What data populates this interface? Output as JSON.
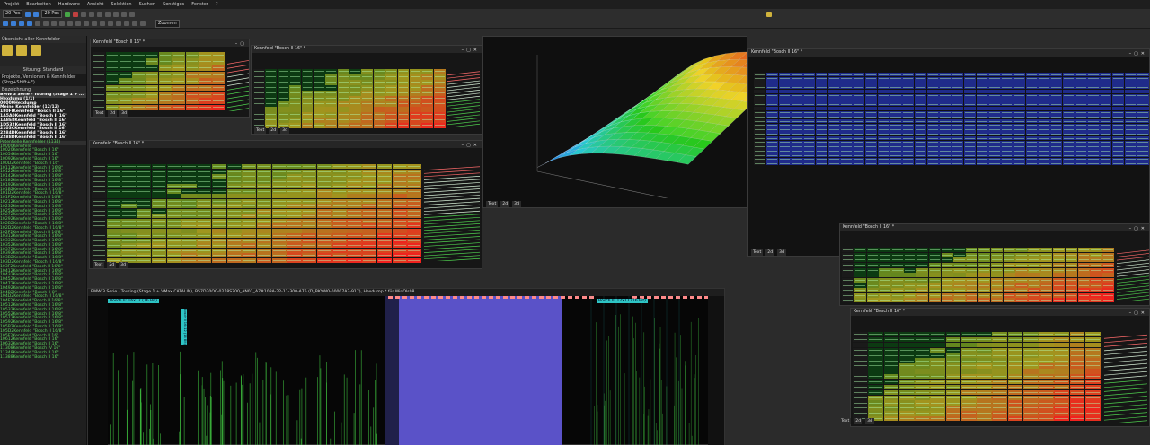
{
  "menu": [
    "Projekt",
    "Bearbeiten",
    "Hardware",
    "Ansicht",
    "Selektion",
    "Suchen",
    "Sonstiges",
    "Fenster",
    "?"
  ],
  "toolbar": {
    "addr_combo": "20 Pos",
    "zoom_combo": "20 Pos",
    "zoom_label": "Zoomen"
  },
  "left_panel": {
    "title": "Übersicht aller Kennfelder",
    "mode_label": "Sitzung: Standard",
    "project_label": "Projekte, Versionen & Kennfelder (Strg+Shift+F)",
    "column_label": "Bezeichnung",
    "tree_header": "BMW 3 Serie - Touring (Stage 1 + ...",
    "items_white": [
      "Hexdump (1/1)",
      "00000Hexdump",
      "Meine Kennfelder (12/12)",
      "180FIKennfeld \"Bosch II 16\"",
      "1A5A0Kennfeld \"Bosch II 16\"",
      "1A8E8Kennfeld \"Bosch II 16\"",
      "1D532Kennfeld \"Bosch II 16\"",
      "2103CKennfeld \"Bosch II 16\"",
      "2284DKennfeld \"Bosch II 16\"",
      "2288DKennfeld \"Bosch II 16\""
    ],
    "items_green_header": "Potentielle Kennfelder (1134)",
    "items_green": [
      "10000Kennfeld",
      "10020Kennfeld \"Bosch II 16\"",
      "10054Kennfeld \"Bosch II 16\"",
      "10092Kennfeld \"Bosch II 16\"",
      "100D2Kennfeld \"Bosch II 16\"",
      "10112Kennfeld \"Bosch II 16/8\"",
      "10122Kennfeld \"Bosch II 16/8\"",
      "10142Kennfeld \"Bosch II 16/8\"",
      "10182Kennfeld \"Bosch II 16/8\"",
      "10192Kennfeld \"Bosch II 16/8\"",
      "101B2Kennfeld \"Bosch II 16/8\"",
      "101D2Kennfeld \"Bosch II 16/8\"",
      "101F2Kennfeld \"Bosch II 16/8\"",
      "10212Kennfeld \"Bosch II 16/8\"",
      "10232Kennfeld \"Bosch II 16/8\"",
      "10252Kennfeld \"Bosch II 16/8\"",
      "10272Kennfeld \"Bosch II 16/8\"",
      "10292Kennfeld \"Bosch II 16/8\"",
      "102B2Kennfeld \"Bosch II 16/8\"",
      "102D2Kennfeld \"Bosch II 16/8\"",
      "102F2Kennfeld \"Bosch II 16/8\"",
      "10312Kennfeld \"Bosch II 16/8\"",
      "10332Kennfeld \"Bosch II 16/8\"",
      "10352Kennfeld \"Bosch II 16/8\"",
      "10372Kennfeld \"Bosch II 16/8\"",
      "10392Kennfeld \"Bosch II 16/8\"",
      "103B2Kennfeld \"Bosch II 16/8\"",
      "103D2Kennfeld \"Bosch II 16/8\"",
      "103F2Kennfeld \"Bosch II 16/8\"",
      "10412Kennfeld \"Bosch II 16/8\"",
      "10432Kennfeld \"Bosch II 16/8\"",
      "10452Kennfeld \"Bosch II 16/8\"",
      "10472Kennfeld \"Bosch II 16/8\"",
      "10492Kennfeld \"Bosch II 16/8\"",
      "104B2Kennfeld \"Bosch II 8\"",
      "104D2Kennfeld \"Bosch II 16/8\"",
      "104F2Kennfeld \"Bosch II 16/8\"",
      "10512Kennfeld \"Bosch II 16/8\"",
      "10532Kennfeld \"Bosch II 16/8\"",
      "10552Kennfeld \"Bosch II 16/8\"",
      "10572Kennfeld \"Bosch II 16/8\"",
      "10592Kennfeld \"Bosch II 16/8\"",
      "105B2Kennfeld \"Bosch II 16/8\"",
      "105D2Kennfeld \"Bosch II 16/8\"",
      "105F2Kennfeld \"Bosch II 16\"",
      "10612Kennfeld \"Bosch II 16\"",
      "10632Kennfeld \"Bosch II 16\"",
      "11308Kennfeld \"Bosch IV 16\"",
      "11348Kennfeld \"Bosch II 16\"",
      "11388Kennfeld \"Bosch II 16\""
    ]
  },
  "windows": {
    "w1_title": "Kennfeld \"Bosch II 16\" *",
    "w2_title": "Kennfeld \"Bosch II 16\" *",
    "w3_title": "Kennfeld \"Bosch II 16\" *",
    "w4_title": "Kennfeld \"Bosch II 16\" *",
    "w5_title": "Kennfeld \"Bosch II 16\" *",
    "w6_title": "Kennfeld \"Bosch II 16\" *",
    "tab_text": "Text",
    "tab_2d": "2d",
    "tab_3d": "3d",
    "axis_marker": "<\\/>"
  },
  "hex": {
    "title": "BMW 3 Serie - Touring (Stage 1 + VMax CATALIN), B57D30O0-0218S700_AN01_A7#108A-22-11-300-A75 (D_BKYW0-00007A3-917), Hexdump * für WinOls08",
    "note1": "Bosch II: 16x12 (16 Bit)",
    "note2": "Bosch II: 12x17 (16 Bit)",
    "note3": "Bosch II 16x12 (16 Bit)"
  },
  "colors": {
    "accent": "#2ec4c4",
    "green": "#4fcc4f",
    "selection": "#5a52c8",
    "marker": "#ff7d7d"
  }
}
